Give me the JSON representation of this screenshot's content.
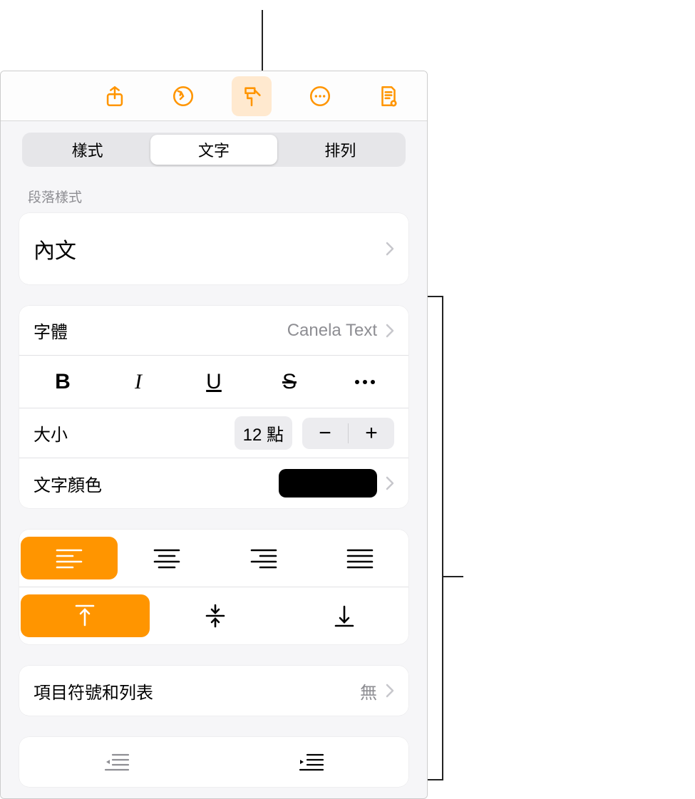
{
  "toolbar": {
    "icons": [
      "share",
      "undo",
      "format",
      "more",
      "document"
    ]
  },
  "tabs": {
    "items": [
      "樣式",
      "文字",
      "排列"
    ],
    "selected": 1
  },
  "sections": {
    "paragraph_style_header": "段落樣式",
    "paragraph_style_value": "內文",
    "font_label": "字體",
    "font_value": "Canela Text",
    "style_buttons": {
      "bold": "B",
      "italic": "I",
      "underline": "U",
      "strike": "S"
    },
    "size_label": "大小",
    "size_value": "12 點",
    "color_label": "文字顏色",
    "color_value": "#000000",
    "bullets_label": "項目符號和列表",
    "bullets_value": "無"
  },
  "alignment": {
    "horizontal_selected": 0,
    "vertical_selected": 0
  }
}
